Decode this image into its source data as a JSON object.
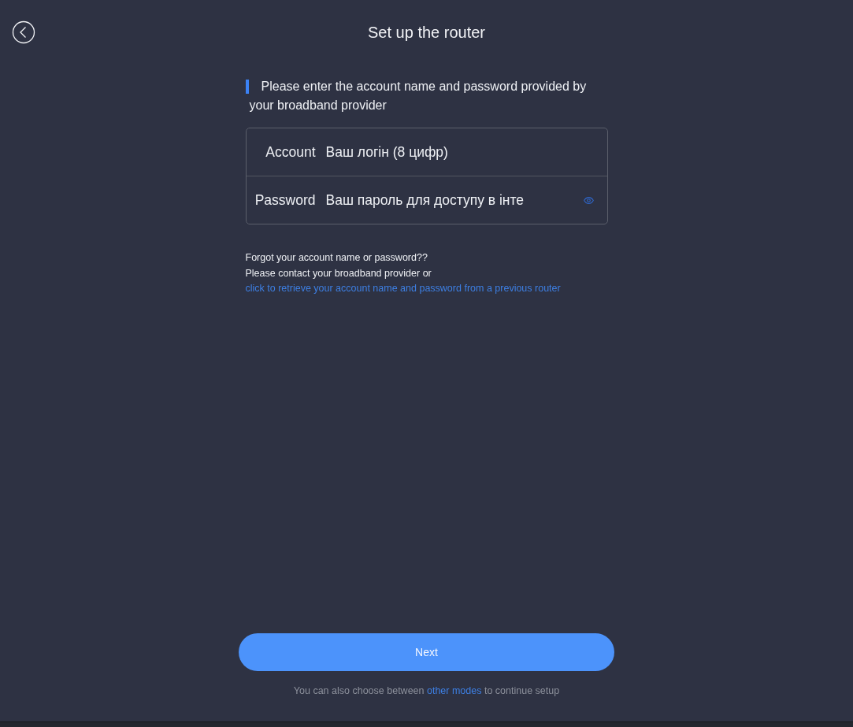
{
  "header": {
    "title": "Set up the router"
  },
  "instruction": "Please enter the account name and password provided by your broadband provider",
  "fields": [
    {
      "kind": "text",
      "label": "Account",
      "value": "Ваш логін (8 цифр)"
    },
    {
      "kind": "password",
      "label": "Password",
      "value": "Ваш пароль для доступу в інте"
    }
  ],
  "help": {
    "question": "Forgot your account name or password??",
    "text": "Please contact your broadband provider or",
    "link": "click to retrieve your account name and password from a previous router"
  },
  "next_button": "Next",
  "footer": {
    "text_before": "You can also choose between",
    "link": "other modes",
    "text_after": "to continue setup"
  }
}
